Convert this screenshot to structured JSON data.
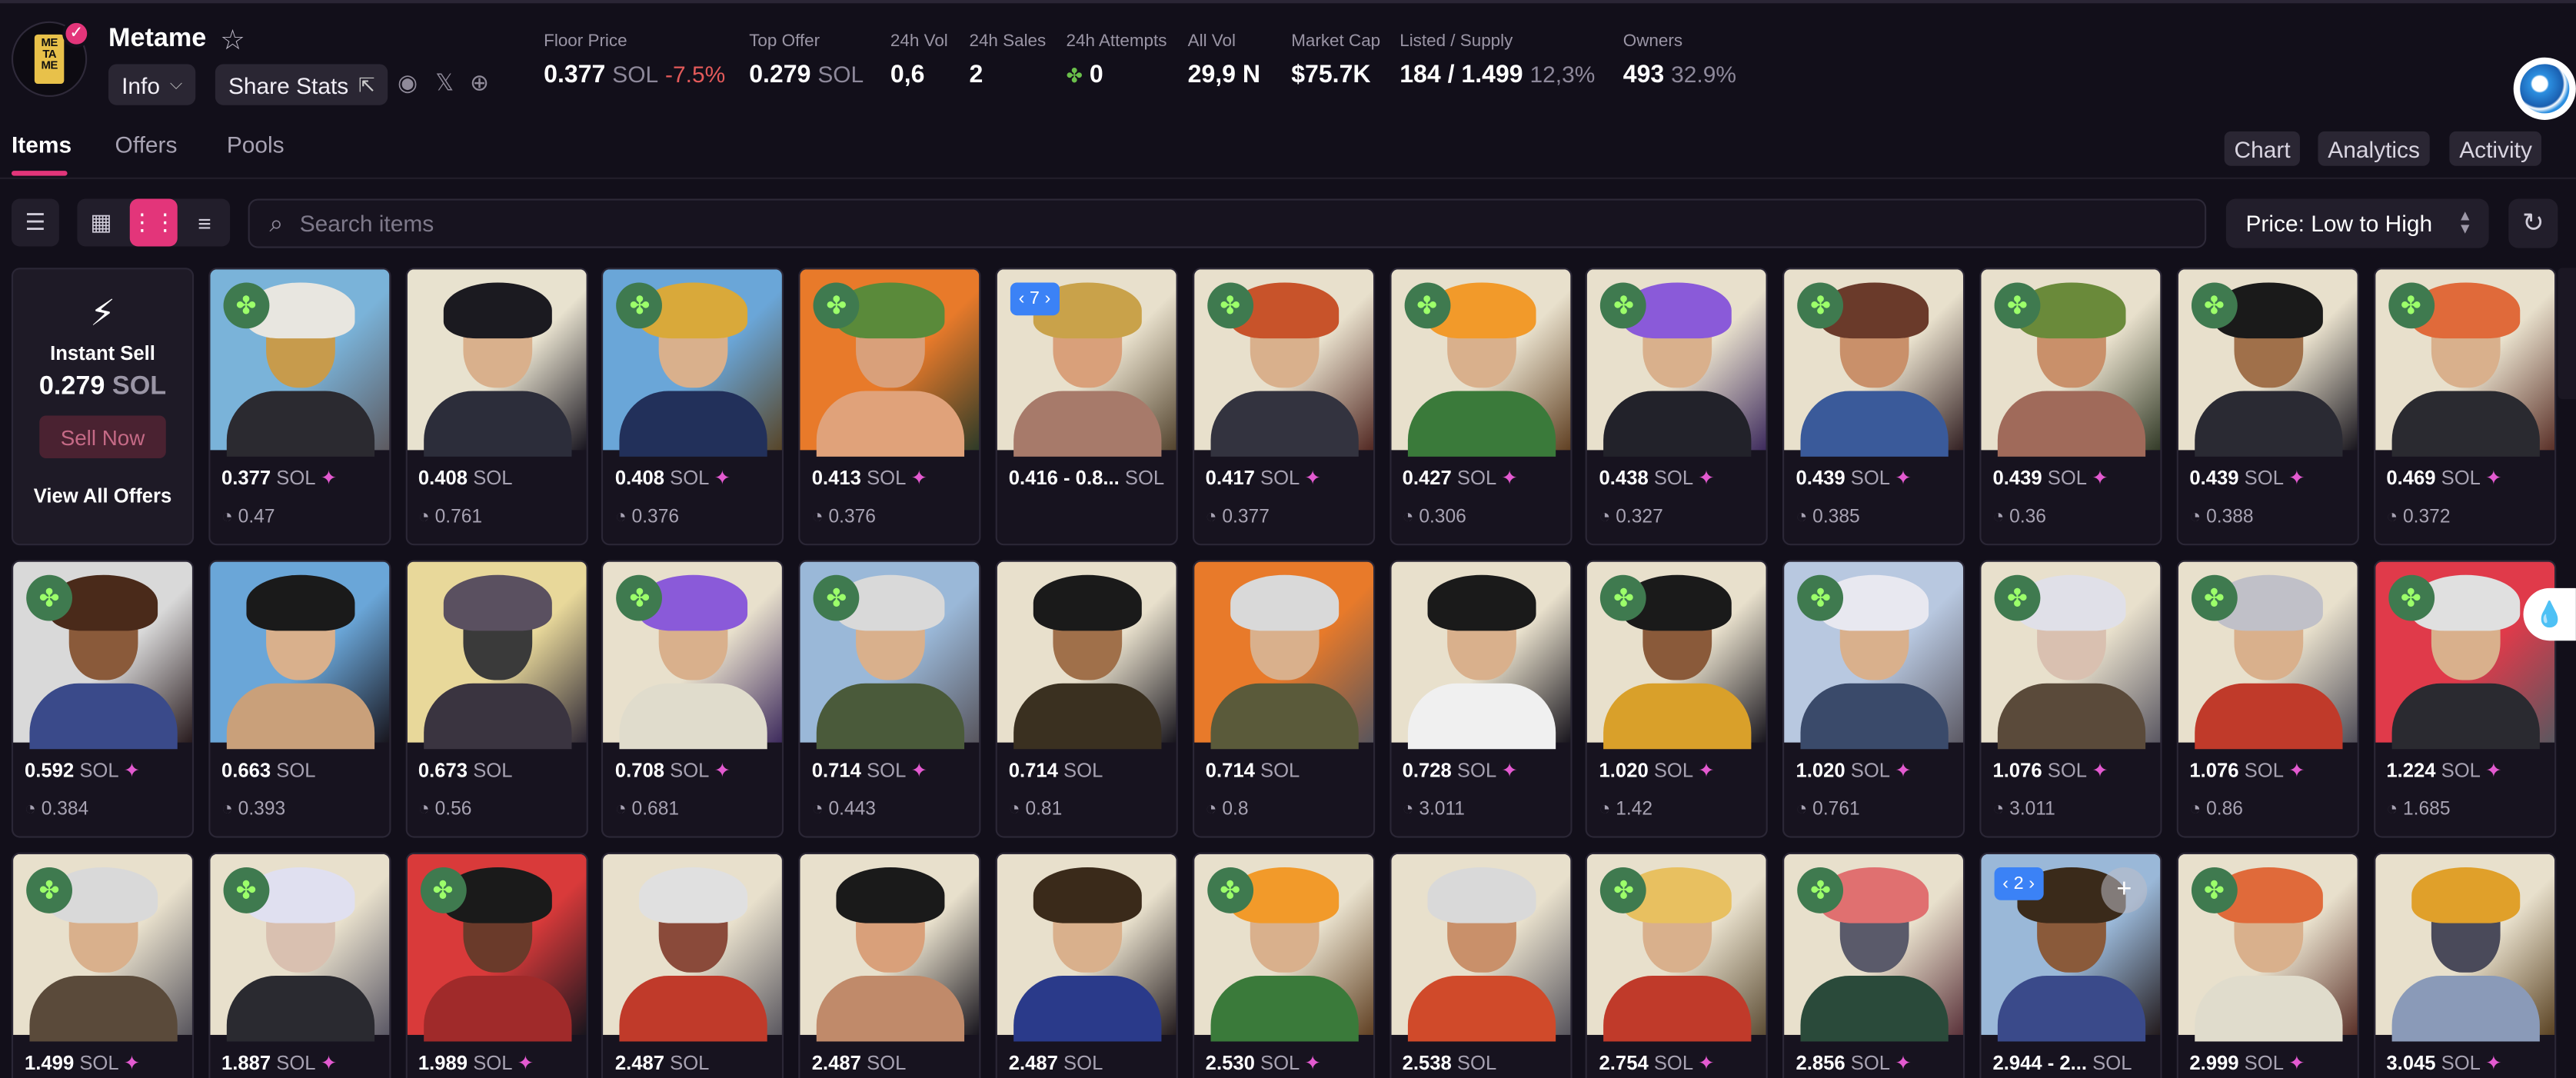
{
  "collection": {
    "name": "Metame",
    "logo_text": "ME\nTA\nME",
    "info_label": "Info",
    "share_label": "Share Stats"
  },
  "stats": [
    {
      "label": "Floor Price",
      "value": "0.377",
      "unit": "SOL",
      "extra": "-7.5%"
    },
    {
      "label": "Top Offer",
      "value": "0.279",
      "unit": "SOL",
      "extra": ""
    },
    {
      "label": "24h Vol",
      "value": "0,6",
      "unit": "",
      "extra": ""
    },
    {
      "label": "24h Sales",
      "value": "2",
      "unit": "",
      "extra": ""
    },
    {
      "label": "24h Attempts",
      "value": "0",
      "unit": "",
      "extra": ""
    },
    {
      "label": "All Vol",
      "value": "29,9 N",
      "unit": "",
      "extra": ""
    },
    {
      "label": "Market Cap",
      "value": "$75.7K",
      "unit": "",
      "extra": ""
    },
    {
      "label": "Listed / Supply",
      "value": "184 / 1.499",
      "unit": "",
      "extra": "12,3%"
    },
    {
      "label": "Owners",
      "value": "493",
      "unit": "",
      "extra": "32.9%"
    }
  ],
  "tabs": [
    "Items",
    "Offers",
    "Pools"
  ],
  "right_tabs": [
    "Chart",
    "Analytics",
    "Activity"
  ],
  "search": {
    "placeholder": "Search items"
  },
  "sort": {
    "selected": "Price: Low to High"
  },
  "instant_sell": {
    "title": "Instant Sell",
    "price": "0.279",
    "unit": "SOL",
    "button": "Sell Now",
    "link": "View All Offers"
  },
  "items_row1": [
    {
      "price": "0.377",
      "offer": "0.47",
      "badge": "clover",
      "spark": true,
      "palette": [
        "#7ab3d9",
        "#e8e6e0",
        "#2b2a30",
        "#c79b4c"
      ]
    },
    {
      "price": "0.408",
      "offer": "0.761",
      "badge": "",
      "spark": false,
      "palette": [
        "#e8e2cf",
        "#1b1a20",
        "#2c2d3a",
        "#d9b08c"
      ]
    },
    {
      "price": "0.408",
      "offer": "0.376",
      "badge": "clover",
      "spark": true,
      "palette": [
        "#6aa6d8",
        "#d9a93a",
        "#22305a",
        "#d9b08c"
      ]
    },
    {
      "price": "0.413",
      "offer": "0.376",
      "badge": "clover",
      "spark": true,
      "palette": [
        "#e87a2a",
        "#5a8a3a",
        "#e0a27a",
        "#d9a07a"
      ]
    },
    {
      "price": "0.416 - 0.8...",
      "offer": "",
      "badge": "count",
      "count": "7",
      "spark": false,
      "palette": [
        "#e8e0cc",
        "#c9a24a",
        "#a77a6a",
        "#d9a07a"
      ]
    },
    {
      "price": "0.417",
      "offer": "0.377",
      "badge": "clover",
      "spark": true,
      "palette": [
        "#e8e0cc",
        "#c8532a",
        "#33333f",
        "#d9b08c"
      ]
    },
    {
      "price": "0.427",
      "offer": "0.306",
      "badge": "clover",
      "spark": true,
      "palette": [
        "#e8e0cc",
        "#f29a2a",
        "#3a7a3a",
        "#d9b08c"
      ]
    },
    {
      "price": "0.438",
      "offer": "0.327",
      "badge": "clover",
      "spark": true,
      "palette": [
        "#e8e0cc",
        "#8a5ad9",
        "#22222a",
        "#d9b08c"
      ]
    },
    {
      "price": "0.439",
      "offer": "0.385",
      "badge": "clover",
      "spark": true,
      "palette": [
        "#e8e0cc",
        "#6a3a2a",
        "#3a5a9a",
        "#c9906a"
      ]
    },
    {
      "price": "0.439",
      "offer": "0.36",
      "badge": "clover",
      "spark": true,
      "palette": [
        "#e8e0cc",
        "#6a8a3a",
        "#a06a5a",
        "#c9906a"
      ]
    },
    {
      "price": "0.439",
      "offer": "0.388",
      "badge": "clover",
      "spark": true,
      "palette": [
        "#e8e0cc",
        "#1a1a1a",
        "#2a2a33",
        "#a0704a"
      ]
    },
    {
      "price": "0.469",
      "offer": "0.372",
      "badge": "clover",
      "spark": true,
      "palette": [
        "#e8e0cc",
        "#e06a3a",
        "#2a2a30",
        "#d9b08c"
      ]
    }
  ],
  "items_row2": [
    {
      "price": "0.592",
      "offer": "0.384",
      "badge": "clover",
      "spark": true,
      "palette": [
        "#d9d9d9",
        "#4a2a1a",
        "#3a4a8a",
        "#8a5a3a"
      ]
    },
    {
      "price": "0.663",
      "offer": "0.393",
      "badge": "",
      "spark": false,
      "palette": [
        "#6aa6d8",
        "#1a1a1a",
        "#c9a07a",
        "#d9b08c"
      ]
    },
    {
      "price": "0.673",
      "offer": "0.56",
      "badge": "",
      "spark": false,
      "palette": [
        "#e8d89a",
        "#5a5060",
        "#3a3440",
        "#3a3a3a"
      ]
    },
    {
      "price": "0.708",
      "offer": "0.681",
      "badge": "clover",
      "spark": true,
      "palette": [
        "#e8e0cc",
        "#8a5ad9",
        "#e0dccc",
        "#d9b08c"
      ]
    },
    {
      "price": "0.714",
      "offer": "0.443",
      "badge": "clover",
      "spark": true,
      "palette": [
        "#9ab8d8",
        "#d9d9d9",
        "#4a5a3a",
        "#d9b08c"
      ]
    },
    {
      "price": "0.714",
      "offer": "0.81",
      "badge": "",
      "spark": false,
      "palette": [
        "#e8e0cc",
        "#1a1a1a",
        "#3a3020",
        "#a0704a"
      ]
    },
    {
      "price": "0.714",
      "offer": "0.8",
      "badge": "",
      "spark": false,
      "palette": [
        "#e87a2a",
        "#d9d9d9",
        "#5a5a3a",
        "#d9b08c"
      ]
    },
    {
      "price": "0.728",
      "offer": "3.011",
      "badge": "",
      "spark": true,
      "palette": [
        "#e8e0cc",
        "#1a1a1a",
        "#f0f0f0",
        "#d9b08c"
      ]
    },
    {
      "price": "1.020",
      "offer": "1.42",
      "badge": "clover",
      "spark": true,
      "palette": [
        "#e8e0cc",
        "#1a1a1a",
        "#d9a02a",
        "#8a5a3a"
      ]
    },
    {
      "price": "1.020",
      "offer": "0.761",
      "badge": "clover",
      "spark": true,
      "palette": [
        "#b8c8e0",
        "#e8e8f0",
        "#3a4a6a",
        "#d9b08c"
      ]
    },
    {
      "price": "1.076",
      "offer": "3.011",
      "badge": "clover",
      "spark": true,
      "palette": [
        "#e8e0cc",
        "#e0e0e8",
        "#5a4a3a",
        "#d9c0b0"
      ]
    },
    {
      "price": "1.076",
      "offer": "0.86",
      "badge": "clover",
      "spark": true,
      "palette": [
        "#e8e0cc",
        "#c0c0c8",
        "#c03a2a",
        "#d9b08c"
      ]
    },
    {
      "price": "1.224",
      "offer": "1.685",
      "badge": "clover",
      "spark": true,
      "palette": [
        "#e03a4a",
        "#e0e0e0",
        "#2a2a30",
        "#d9b08c"
      ]
    }
  ],
  "items_row3": [
    {
      "price": "1.499",
      "badge": "clover",
      "spark": true,
      "palette": [
        "#e8e0cc",
        "#d9d9d9",
        "#5a4a3a",
        "#d9b08c"
      ]
    },
    {
      "price": "1.887",
      "badge": "clover",
      "spark": true,
      "palette": [
        "#e8e0cc",
        "#e0e0f0",
        "#2a2a30",
        "#d9c0b0"
      ]
    },
    {
      "price": "1.989",
      "badge": "clover",
      "spark": true,
      "palette": [
        "#d93a3a",
        "#1a1a1a",
        "#a02a2a",
        "#6a3a2a"
      ]
    },
    {
      "price": "2.487",
      "badge": "",
      "spark": false,
      "palette": [
        "#e8e0cc",
        "#e0e0e0",
        "#c03a2a",
        "#8a4a3a"
      ]
    },
    {
      "price": "2.487",
      "badge": "",
      "spark": false,
      "palette": [
        "#e8e0cc",
        "#1a1a1a",
        "#c08a6a",
        "#d9a07a"
      ]
    },
    {
      "price": "2.487",
      "badge": "",
      "spark": false,
      "palette": [
        "#e8e0cc",
        "#3a2a1a",
        "#2a3a8a",
        "#d9b08c"
      ]
    },
    {
      "price": "2.530",
      "badge": "clover",
      "spark": true,
      "palette": [
        "#e8e0cc",
        "#f29a2a",
        "#3a7a3a",
        "#d9b08c"
      ]
    },
    {
      "price": "2.538",
      "badge": "",
      "spark": false,
      "palette": [
        "#e8e0cc",
        "#d9d9d9",
        "#d04a2a",
        "#c9906a"
      ]
    },
    {
      "price": "2.754",
      "badge": "clover",
      "spark": true,
      "palette": [
        "#e8e0cc",
        "#e8c060",
        "#c03a2a",
        "#d9b08c"
      ]
    },
    {
      "price": "2.856",
      "badge": "clover",
      "spark": true,
      "palette": [
        "#e8e0cc",
        "#e07070",
        "#2a4a3a",
        "#5a5a6a"
      ]
    },
    {
      "price": "2.944 - 2...",
      "badge": "count",
      "count": "2",
      "plus": true,
      "spark": false,
      "palette": [
        "#9ab8d8",
        "#3a2a1a",
        "#3a4a8a",
        "#8a5a3a"
      ]
    },
    {
      "price": "2.999",
      "badge": "clover",
      "spark": true,
      "palette": [
        "#e8e0cc",
        "#e06a3a",
        "#e0dccc",
        "#d9b08c"
      ]
    },
    {
      "price": "3.045",
      "badge": "",
      "spark": true,
      "palette": [
        "#e8e0cc",
        "#e0a02a",
        "#8a9ab8",
        "#4a4a5a"
      ]
    }
  ],
  "unit": "SOL"
}
